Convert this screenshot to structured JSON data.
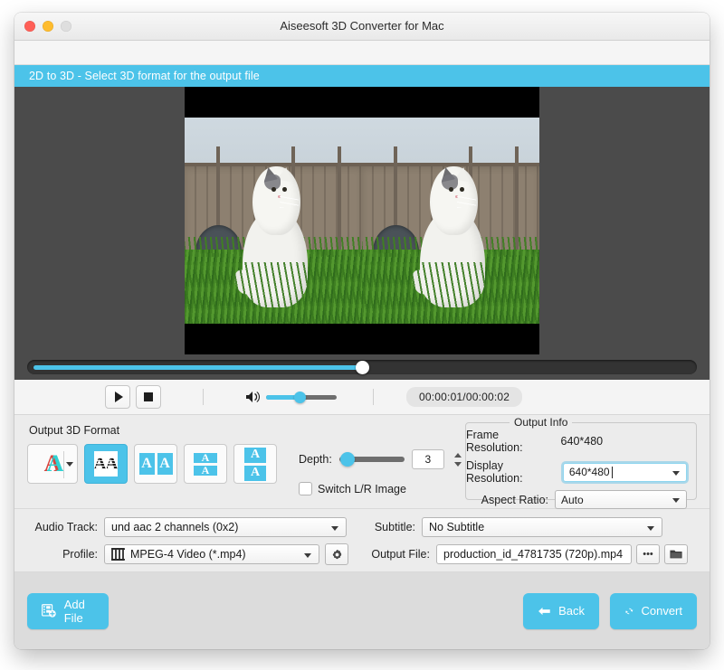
{
  "window": {
    "title": "Aiseesoft 3D Converter for Mac",
    "traffic_lights": [
      "close",
      "minimize",
      "zoom-disabled"
    ]
  },
  "banner": {
    "text": "2D to 3D - Select 3D format for the output file"
  },
  "preview": {
    "description": "Side-by-side 3D preview of a kitten sitting in grass in front of a wooden fence",
    "scrub_position_percent": 50
  },
  "transport": {
    "play_icon": "play-icon",
    "stop_icon": "stop-icon",
    "volume_icon": "speaker-icon",
    "volume_percent": 47,
    "time": "00:00:01/00:00:02"
  },
  "format_section": {
    "title": "Output 3D Format",
    "formats": [
      {
        "name": "anaglyph",
        "label": "A",
        "selected": false,
        "has_dropdown": true
      },
      {
        "name": "interlaced",
        "label": "AA",
        "selected": true,
        "has_dropdown": false
      },
      {
        "name": "side-by-side-full",
        "label": "A A",
        "selected": false,
        "has_dropdown": false
      },
      {
        "name": "top-bottom-half",
        "label": "A/A",
        "selected": false,
        "has_dropdown": false
      },
      {
        "name": "top-bottom-full",
        "label": "A/A",
        "selected": false,
        "has_dropdown": false
      }
    ],
    "depth_label": "Depth:",
    "depth_value": "3",
    "depth_percent": 4,
    "switch_lr_label": "Switch L/R Image",
    "switch_lr_checked": false
  },
  "output_info": {
    "legend": "Output Info",
    "frame_resolution_label": "Frame Resolution:",
    "frame_resolution_value": "640*480",
    "display_resolution_label": "Display Resolution:",
    "display_resolution_value": "640*480",
    "display_resolution_focused": true,
    "aspect_ratio_label": "Aspect Ratio:",
    "aspect_ratio_value": "Auto"
  },
  "form": {
    "audio_track_label": "Audio Track:",
    "audio_track_value": "und aac 2 channels (0x2)",
    "subtitle_label": "Subtitle:",
    "subtitle_value": "No Subtitle",
    "profile_label": "Profile:",
    "profile_value": "MPEG-4 Video (*.mp4)",
    "profile_icon": "mpeg-film-icon",
    "settings_icon": "gear-icon",
    "output_file_label": "Output File:",
    "output_file_value": "production_id_4781735 (720p).mp4",
    "browse_label": "•••",
    "folder_icon": "folder-icon"
  },
  "footer": {
    "add_file_label": "Add File",
    "add_file_icon": "film-add-icon",
    "back_label": "Back",
    "back_icon": "arrow-left-icon",
    "convert_label": "Convert",
    "convert_icon": "refresh-icon"
  },
  "colors": {
    "accent": "#4cc3e9",
    "window_bg": "#ececec",
    "footer_bg": "#dcdcdc",
    "preview_bg": "#4b4b4b"
  }
}
